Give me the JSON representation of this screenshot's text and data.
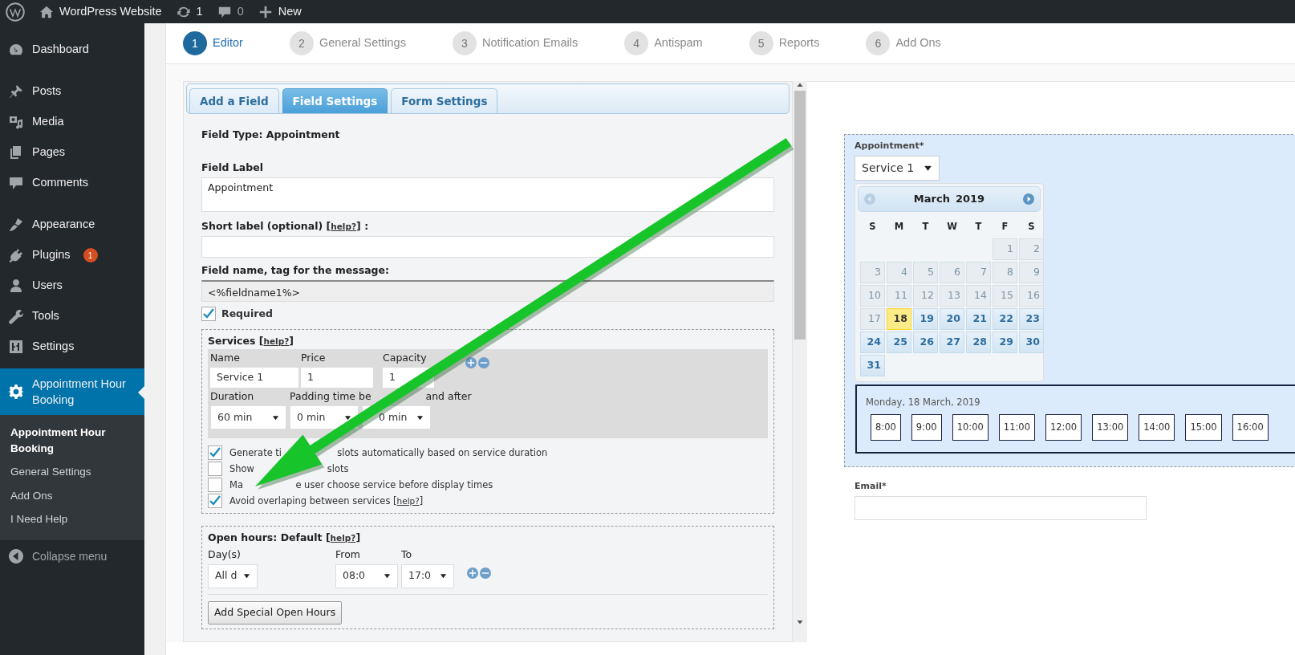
{
  "admin_bar": [
    {
      "kind": "logo"
    },
    {
      "kind": "home",
      "label": "WordPress Website"
    },
    {
      "kind": "updates",
      "label": "1"
    },
    {
      "kind": "comments",
      "label": "0"
    },
    {
      "kind": "new",
      "label": "New"
    }
  ],
  "sidebar": {
    "items": [
      {
        "kind": "dashboard",
        "label": "Dashboard",
        "selected": false
      },
      {
        "kind": "posts",
        "label": "Posts",
        "selected": false
      },
      {
        "kind": "media",
        "label": "Media",
        "selected": false
      },
      {
        "kind": "pages",
        "label": "Pages",
        "selected": false
      },
      {
        "kind": "comments",
        "label": "Comments",
        "selected": false
      },
      {
        "kind": "appearance",
        "label": "Appearance",
        "selected": false
      },
      {
        "kind": "plugins",
        "label": "Plugins",
        "badge": "1",
        "selected": false
      },
      {
        "kind": "users",
        "label": "Users",
        "selected": false
      },
      {
        "kind": "tools",
        "label": "Tools",
        "selected": false
      },
      {
        "kind": "settings",
        "label": "Settings",
        "selected": false
      },
      {
        "kind": "booking",
        "label": "Appointment Hour Booking",
        "selected": true
      }
    ],
    "submenu": [
      {
        "label": "Appointment Hour Booking",
        "selected": true
      },
      {
        "label": "General Settings",
        "selected": false
      },
      {
        "label": "Add Ons",
        "selected": false
      },
      {
        "label": "I Need Help",
        "selected": false
      }
    ],
    "collapse": "Collapse menu"
  },
  "steps": [
    {
      "number": "1",
      "label": "Editor",
      "selected": true
    },
    {
      "number": "2",
      "label": "General Settings",
      "selected": false
    },
    {
      "number": "3",
      "label": "Notification Emails",
      "selected": false
    },
    {
      "number": "4",
      "label": "Antispam",
      "selected": false
    },
    {
      "number": "5",
      "label": "Reports",
      "selected": false
    },
    {
      "number": "6",
      "label": "Add Ons",
      "selected": false
    }
  ],
  "editor_tabs": [
    {
      "label": "Add a Field",
      "selected": false
    },
    {
      "label": "Field Settings",
      "selected": true
    },
    {
      "label": "Form Settings",
      "selected": false
    }
  ],
  "field_type": "Field Type: Appointment",
  "field_label": {
    "label": "Field Label",
    "value": "Appointment"
  },
  "short_label": {
    "label": "Short label (optional) [",
    "help": "help?",
    "after": "] :"
  },
  "field_name": {
    "label": "Field name, tag for the message:",
    "value": "<%fieldname1%>"
  },
  "required": {
    "label": "Required",
    "checked": true
  },
  "services": {
    "title": "Services",
    "help_before": "[",
    "help": "help?",
    "help_after": "]",
    "name": {
      "label": "Name",
      "value": "Service 1"
    },
    "price": {
      "label": "Price",
      "value": "1"
    },
    "capacity": {
      "label": "Capacity",
      "value": "1"
    },
    "duration": {
      "label": "Duration",
      "value": "60 min"
    },
    "padding": {
      "label_parts": [
        "Padding time be",
        "and after"
      ],
      "before": "0 min",
      "after": "0 min"
    },
    "options": [
      {
        "label_parts": [
          "Generate ti",
          "slots automatically based on service duration"
        ],
        "checked": true
      },
      {
        "label_parts": [
          "Show",
          "slots"
        ],
        "checked": false
      },
      {
        "label_parts": [
          "Ma",
          "e user choose service before display times"
        ],
        "checked": false
      },
      {
        "label_parts": [
          "Avoid overlaping between services"
        ],
        "checked": true,
        "help_before": "[",
        "help": "help?",
        "help_after": "]"
      }
    ]
  },
  "open_hours": {
    "title": "Open hours: Default",
    "help_before": "[",
    "help": "help?",
    "help_after": "]",
    "days": {
      "label": "Day(s)",
      "value": "All d"
    },
    "from": {
      "label": "From",
      "value": "08:0"
    },
    "to": {
      "label": "To",
      "value": "17:0"
    },
    "button": "Add Special Open Hours"
  },
  "preview": {
    "field_label": "Appointment*",
    "service": "Service 1",
    "calendar": {
      "month": "March",
      "year": "2019",
      "weekdays": [
        "S",
        "M",
        "T",
        "W",
        "T",
        "F",
        "S"
      ],
      "weeks": [
        [
          {
            "kind": "blank"
          },
          {
            "kind": "blank"
          },
          {
            "kind": "blank"
          },
          {
            "kind": "blank"
          },
          {
            "kind": "blank"
          },
          {
            "kind": "day",
            "label": "1",
            "disabled": true,
            "selected": false
          },
          {
            "kind": "day",
            "label": "2",
            "disabled": true,
            "selected": false
          }
        ],
        [
          {
            "kind": "day",
            "label": "3",
            "disabled": true,
            "selected": false
          },
          {
            "kind": "day",
            "label": "4",
            "disabled": true,
            "selected": false
          },
          {
            "kind": "day",
            "label": "5",
            "disabled": true,
            "selected": false
          },
          {
            "kind": "day",
            "label": "6",
            "disabled": true,
            "selected": false
          },
          {
            "kind": "day",
            "label": "7",
            "disabled": true,
            "selected": false
          },
          {
            "kind": "day",
            "label": "8",
            "disabled": true,
            "selected": false
          },
          {
            "kind": "day",
            "label": "9",
            "disabled": true,
            "selected": false
          }
        ],
        [
          {
            "kind": "day",
            "label": "10",
            "disabled": true,
            "selected": false
          },
          {
            "kind": "day",
            "label": "11",
            "disabled": true,
            "selected": false
          },
          {
            "kind": "day",
            "label": "12",
            "disabled": true,
            "selected": false
          },
          {
            "kind": "day",
            "label": "13",
            "disabled": true,
            "selected": false
          },
          {
            "kind": "day",
            "label": "14",
            "disabled": true,
            "selected": false
          },
          {
            "kind": "day",
            "label": "15",
            "disabled": true,
            "selected": false
          },
          {
            "kind": "day",
            "label": "16",
            "disabled": true,
            "selected": false
          }
        ],
        [
          {
            "kind": "day",
            "label": "17",
            "disabled": true,
            "selected": false
          },
          {
            "kind": "day",
            "label": "18",
            "disabled": false,
            "selected": true
          },
          {
            "kind": "day",
            "label": "19",
            "disabled": false,
            "selected": false
          },
          {
            "kind": "day",
            "label": "20",
            "disabled": false,
            "selected": false
          },
          {
            "kind": "day",
            "label": "21",
            "disabled": false,
            "selected": false
          },
          {
            "kind": "day",
            "label": "22",
            "disabled": false,
            "selected": false
          },
          {
            "kind": "day",
            "label": "23",
            "disabled": false,
            "selected": false
          }
        ],
        [
          {
            "kind": "day",
            "label": "24",
            "disabled": false,
            "selected": false
          },
          {
            "kind": "day",
            "label": "25",
            "disabled": false,
            "selected": false
          },
          {
            "kind": "day",
            "label": "26",
            "disabled": false,
            "selected": false
          },
          {
            "kind": "day",
            "label": "27",
            "disabled": false,
            "selected": false
          },
          {
            "kind": "day",
            "label": "28",
            "disabled": false,
            "selected": false
          },
          {
            "kind": "day",
            "label": "29",
            "disabled": false,
            "selected": false
          },
          {
            "kind": "day",
            "label": "30",
            "disabled": false,
            "selected": false
          }
        ],
        [
          {
            "kind": "day",
            "label": "31",
            "disabled": false,
            "selected": false
          }
        ]
      ]
    },
    "date_heading": "Monday, 18 March, 2019",
    "slots": [
      "8:00",
      "9:00",
      "10:00",
      "11:00",
      "12:00",
      "13:00",
      "14:00",
      "15:00",
      "16:00"
    ],
    "email_label": "Email*"
  }
}
